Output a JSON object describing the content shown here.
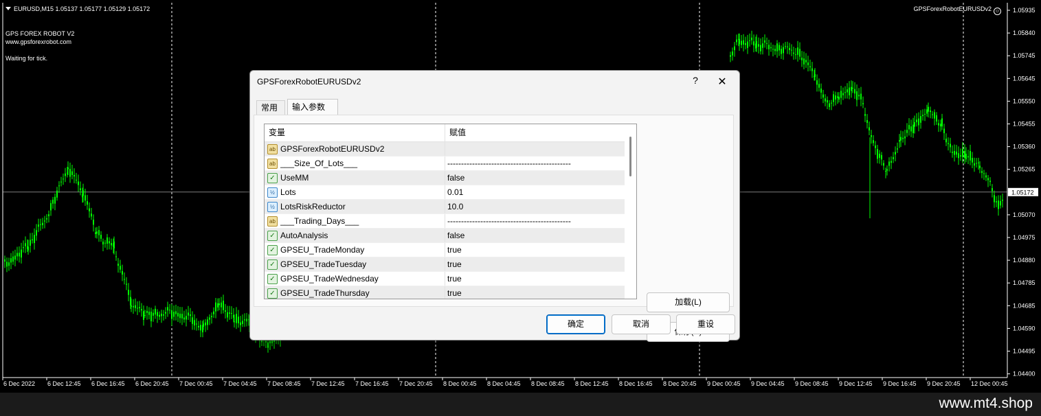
{
  "chart": {
    "symbol_header": "EURUSD,M15  1.05137 1.05177 1.05129 1.05172",
    "ea_label": "GPSForexRobotEURUSDv2",
    "smile_glyph": "☺",
    "info_lines": [
      "GPS FOREX ROBOT V2",
      "www.gpsforexrobot.com",
      "Waiting for tick."
    ],
    "price_labels": [
      "1.05935",
      "1.05840",
      "1.05745",
      "1.05645",
      "1.05550",
      "1.05455",
      "1.05360",
      "1.05265",
      "1.05172",
      "1.05070",
      "1.04975",
      "1.04880",
      "1.04785",
      "1.04685",
      "1.04590",
      "1.04495",
      "1.04400"
    ],
    "current_price": "1.05172",
    "time_labels": [
      "6 Dec 2022",
      "6 Dec 12:45",
      "6 Dec 16:45",
      "6 Dec 20:45",
      "7 Dec 00:45",
      "7 Dec 04:45",
      "7 Dec 08:45",
      "7 Dec 12:45",
      "7 Dec 16:45",
      "7 Dec 20:45",
      "8 Dec 00:45",
      "8 Dec 04:45",
      "8 Dec 08:45",
      "8 Dec 12:45",
      "8 Dec 16:45",
      "8 Dec 20:45",
      "9 Dec 00:45",
      "9 Dec 04:45",
      "9 Dec 08:45",
      "9 Dec 12:45",
      "9 Dec 16:45",
      "9 Dec 20:45",
      "12 Dec 00:45"
    ],
    "colors": {
      "background": "#000000",
      "candles": "#00ff00",
      "grid": "#ffffff",
      "text": "#ffffff"
    }
  },
  "watermark": "www.mt4.shop",
  "dialog": {
    "title": "GPSForexRobotEURUSDv2",
    "help_glyph": "?",
    "close_glyph": "✕",
    "tabs": [
      "常用",
      "输入参数"
    ],
    "active_tab": "输入参数",
    "columns": [
      "变量",
      "赋值"
    ],
    "params": [
      {
        "type": "ab",
        "name": "GPSForexRobotEURUSDv2",
        "value": ""
      },
      {
        "type": "ab",
        "name": "___Size_Of_Lots___",
        "value": "---------------------------------------------"
      },
      {
        "type": "bool",
        "name": "UseMM",
        "value": "false"
      },
      {
        "type": "num",
        "name": "Lots",
        "value": "0.01"
      },
      {
        "type": "num",
        "name": "LotsRiskReductor",
        "value": "10.0"
      },
      {
        "type": "ab",
        "name": "___Trading_Days___",
        "value": "---------------------------------------------"
      },
      {
        "type": "bool",
        "name": "AutoAnalysis",
        "value": "false"
      },
      {
        "type": "bool",
        "name": "GPSEU_TradeMonday",
        "value": "true"
      },
      {
        "type": "bool",
        "name": "GPSEU_TradeTuesday",
        "value": "true"
      },
      {
        "type": "bool",
        "name": "GPSEU_TradeWednesday",
        "value": "true"
      },
      {
        "type": "bool",
        "name": "GPSEU_TradeThursday",
        "value": "true"
      }
    ],
    "icon_glyphs": {
      "ab": "ab",
      "bool": "✓",
      "num": "½"
    },
    "buttons": {
      "load": "加载(L)",
      "save": "保存(S)",
      "ok": "确定",
      "cancel": "取消",
      "reset": "重设"
    }
  }
}
